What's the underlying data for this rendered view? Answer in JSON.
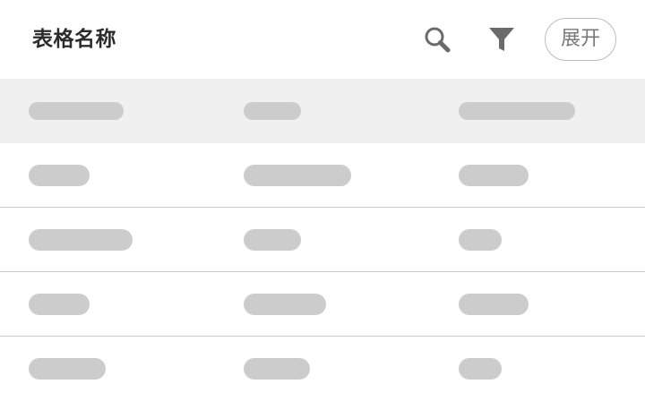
{
  "toolbar": {
    "title": "表格名称",
    "search_icon": "search-icon",
    "filter_icon": "filter-icon",
    "expand_label": "展开"
  },
  "colors": {
    "header_row_bg": "#f0f0f0",
    "placeholder": "#cccccc",
    "divider": "#c8c8c8",
    "icon": "#6b6b6b",
    "title": "#2b2b2b"
  },
  "table": {
    "state": "loading-skeleton",
    "column_count": 3,
    "header_row_count": 1,
    "body_row_count": 4
  }
}
